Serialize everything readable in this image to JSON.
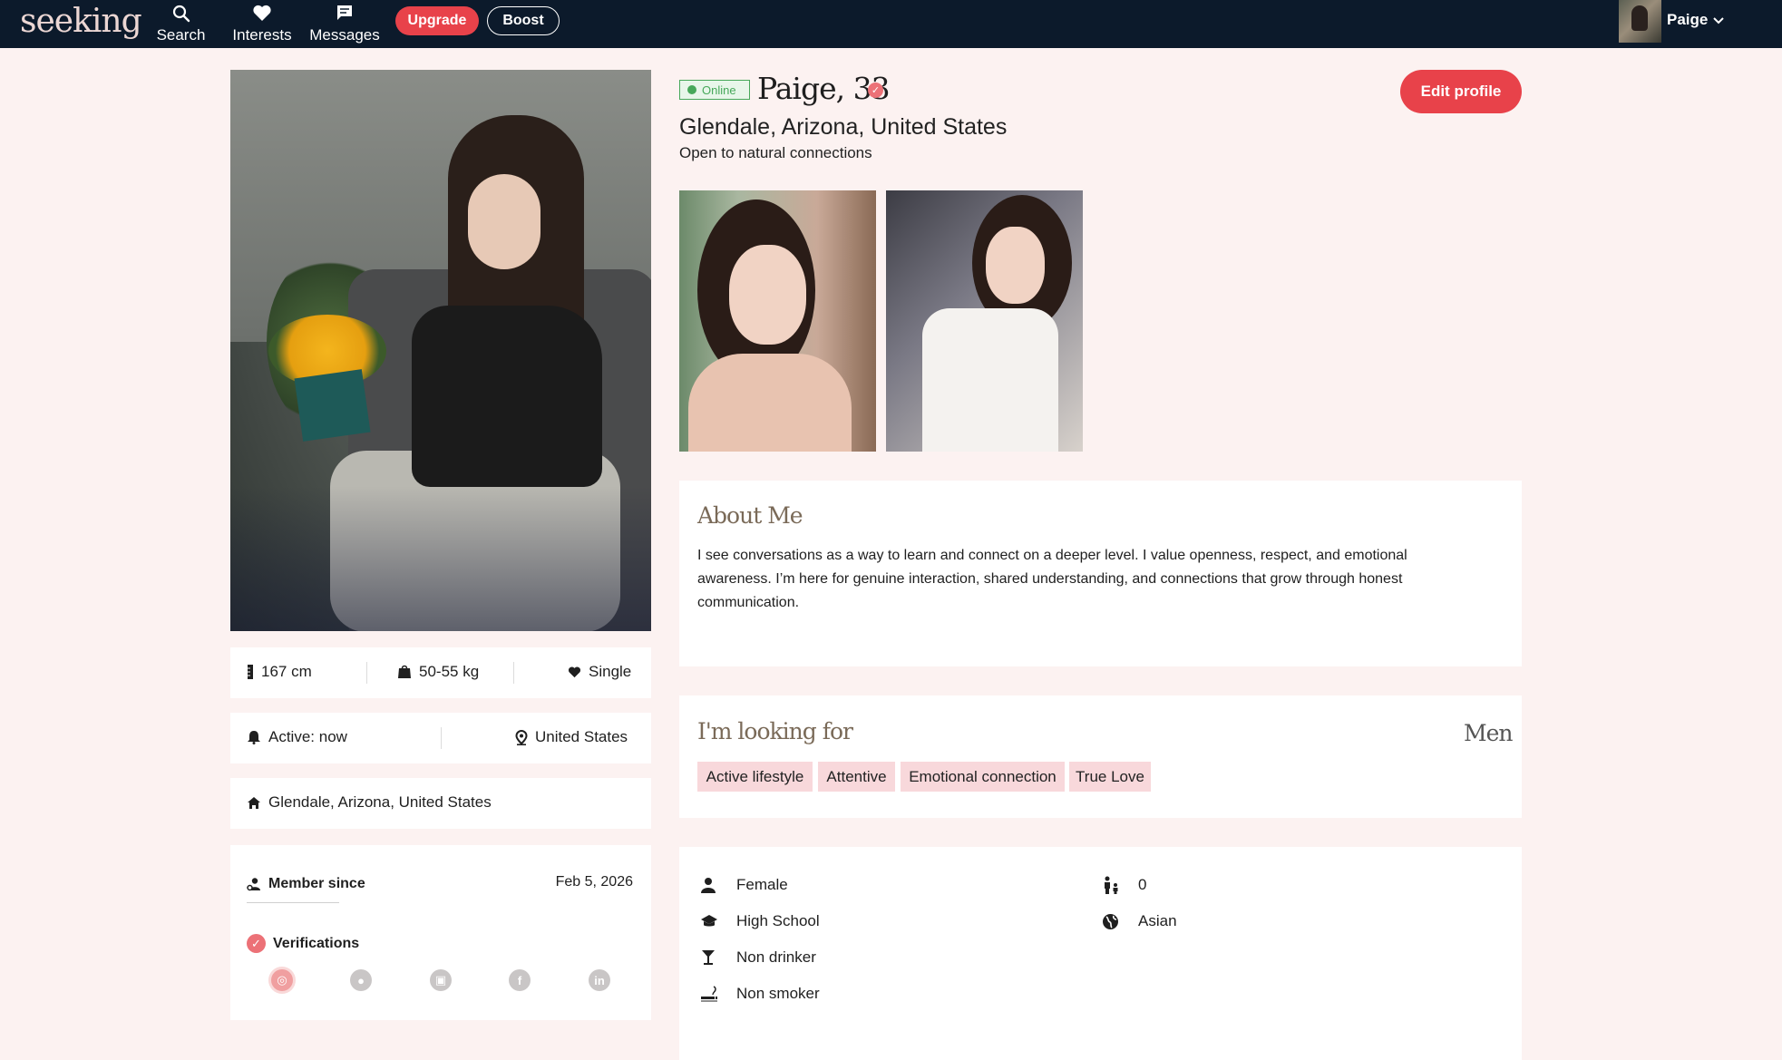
{
  "nav": {
    "logo": "seeking",
    "search_label": "Search",
    "interests_label": "Interests",
    "messages_label": "Messages",
    "upgrade_label": "Upgrade",
    "boost_label": "Boost",
    "user_name": "Paige"
  },
  "profile": {
    "online_label": "Online",
    "name_age": "Paige, 33",
    "location": "Glendale, Arizona, United States",
    "tagline": "Open to natural connections",
    "edit_label": "Edit profile"
  },
  "stats": {
    "height": "167 cm",
    "weight": "50-55 kg",
    "status": "Single",
    "active": "Active: now",
    "country": "United States",
    "home": "Glendale, Arizona, United States",
    "member_since_label": "Member since",
    "member_since_date": "Feb 5, 2026",
    "verifications_label": "Verifications"
  },
  "about": {
    "title": "About Me",
    "text": "I see conversations as a way to learn and connect on a deeper level. I value openness, respect, and emotional awareness. I’m here for genuine interaction, shared understanding, and connections that grow through honest communication."
  },
  "looking_for": {
    "title": "I'm looking for",
    "gender": "Men",
    "tags": [
      "Active lifestyle",
      "Attentive",
      "Emotional connection",
      "True Love"
    ]
  },
  "details": {
    "gender": "Female",
    "education": "High School",
    "drinking": "Non drinker",
    "smoking": "Non smoker",
    "children": "0",
    "ethnicity": "Asian"
  },
  "colors": {
    "nav_bg": "#0c1a2b",
    "accent": "#e8424a",
    "page_bg": "#fcf2f1",
    "tag_bg": "#f8d8db",
    "online": "#47a85a"
  }
}
